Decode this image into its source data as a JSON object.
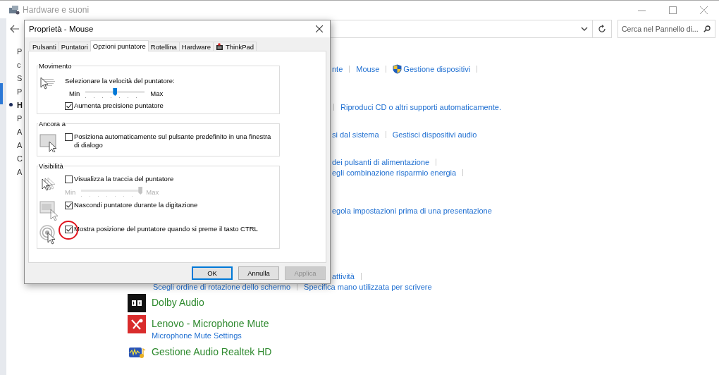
{
  "window": {
    "title": "Hardware e suoni"
  },
  "navigation": {
    "search": {
      "placeholder": "Cerca nel Pannello di..."
    }
  },
  "sidebar": {
    "items": [
      {
        "label": "P",
        "selected": false
      },
      {
        "label": "c",
        "selected": false
      },
      {
        "label": "S",
        "selected": false
      },
      {
        "label": "P",
        "selected": false
      },
      {
        "label": "H",
        "selected": true
      },
      {
        "label": "P",
        "selected": false
      },
      {
        "label": "A",
        "selected": false
      },
      {
        "label": "A",
        "selected": false
      },
      {
        "label": "C",
        "selected": false
      },
      {
        "label": "A",
        "selected": false
      }
    ]
  },
  "content": {
    "sections": [
      {
        "rows": [
          {
            "clipped": true,
            "items": [
              {
                "kind": "link",
                "text": "nte"
              },
              {
                "kind": "separator"
              },
              {
                "kind": "link",
                "text": "Mouse"
              },
              {
                "kind": "separator"
              },
              {
                "kind": "admin-link",
                "text": "Gestione dispositivi"
              },
              {
                "kind": "separator"
              }
            ]
          }
        ]
      },
      {
        "rows": [
          {
            "clipped": true,
            "items": [
              {
                "kind": "separator"
              },
              {
                "kind": "link",
                "text": "Riproduci CD o altri supporti automaticamente."
              }
            ]
          }
        ]
      },
      {
        "rows": [
          {
            "clipped": true,
            "items": [
              {
                "kind": "link",
                "text": "si dal sistema"
              },
              {
                "kind": "separator"
              },
              {
                "kind": "link",
                "text": "Gestisci dispositivi audio"
              }
            ]
          }
        ]
      },
      {
        "rows": [
          {
            "clipped": true,
            "items": [
              {
                "kind": "link",
                "text": "dei pulsanti di alimentazione"
              },
              {
                "kind": "separator"
              }
            ]
          },
          {
            "clipped": true,
            "items": [
              {
                "kind": "link",
                "text": "egli combinazione risparmio energia"
              },
              {
                "kind": "separator"
              }
            ]
          }
        ]
      },
      {
        "rows": [
          {
            "clipped": true,
            "items": [
              {
                "kind": "link",
                "text": "egola impostazioni prima di una presentazione"
              }
            ]
          }
        ]
      },
      {
        "rows": [
          {
            "clipped": true,
            "items": [
              {
                "kind": "link",
                "text": "attività"
              },
              {
                "kind": "separator"
              }
            ]
          },
          {
            "clipped": false,
            "items": [
              {
                "kind": "link",
                "text": "Scegli ordine di rotazione dello schermo"
              },
              {
                "kind": "separator"
              },
              {
                "kind": "link",
                "text": "Specifica mano utilizzata per scrivere"
              }
            ]
          }
        ]
      }
    ],
    "categories": [
      {
        "title": "Dolby Audio"
      },
      {
        "title": "Lenovo - Microphone Mute",
        "link": "Microphone Mute Settings"
      },
      {
        "title": "Gestione Audio Realtek HD"
      }
    ]
  },
  "dialog": {
    "title": "Proprietà - Mouse",
    "tabs": [
      {
        "label": "Pulsanti",
        "selected": false
      },
      {
        "label": "Puntatori",
        "selected": false
      },
      {
        "label": "Opzioni puntatore",
        "selected": true
      },
      {
        "label": "Rotellina",
        "selected": false
      },
      {
        "label": "Hardware",
        "selected": false
      },
      {
        "label": "ThinkPad",
        "selected": false
      }
    ],
    "groups": [
      {
        "title": "Movimento",
        "sections": [
          {
            "items": [
              {
                "kind": "text",
                "text": "Selezionare la velocità del puntatore:"
              },
              {
                "kind": "slider",
                "min_label": "Min",
                "max_label": "Max",
                "level": 0.5,
                "disabled": false
              },
              {
                "kind": "checkbox",
                "label": "Aumenta precisione puntatore",
                "checked": true,
                "highlighted": false
              }
            ]
          }
        ]
      },
      {
        "title": "Ancora a",
        "sections": [
          {
            "items": [
              {
                "kind": "checkbox",
                "label": "Posiziona automaticamente sul pulsante predefinito in una finestra di dialogo",
                "checked": false,
                "highlighted": false
              }
            ]
          }
        ]
      },
      {
        "title": "Visibilità",
        "sections": [
          {
            "items": [
              {
                "kind": "checkbox",
                "label": "Visualizza la traccia del puntatore",
                "checked": false,
                "highlighted": false
              },
              {
                "kind": "slider",
                "min_label": "Min",
                "max_label": "Max",
                "level": 1,
                "disabled": true
              }
            ]
          },
          {
            "items": [
              {
                "kind": "checkbox",
                "label": "Nascondi puntatore durante la digitazione",
                "checked": true,
                "highlighted": false
              }
            ]
          },
          {
            "items": [
              {
                "kind": "checkbox",
                "label": "Mostra posizione del puntatore quando si preme il tasto CTRL",
                "checked": true,
                "highlighted": true
              }
            ]
          }
        ]
      }
    ],
    "buttons": [
      {
        "label": "OK",
        "default": true,
        "disabled": false
      },
      {
        "label": "Annulla",
        "default": false,
        "disabled": false
      },
      {
        "label": "Applica",
        "default": false,
        "disabled": true
      }
    ]
  }
}
